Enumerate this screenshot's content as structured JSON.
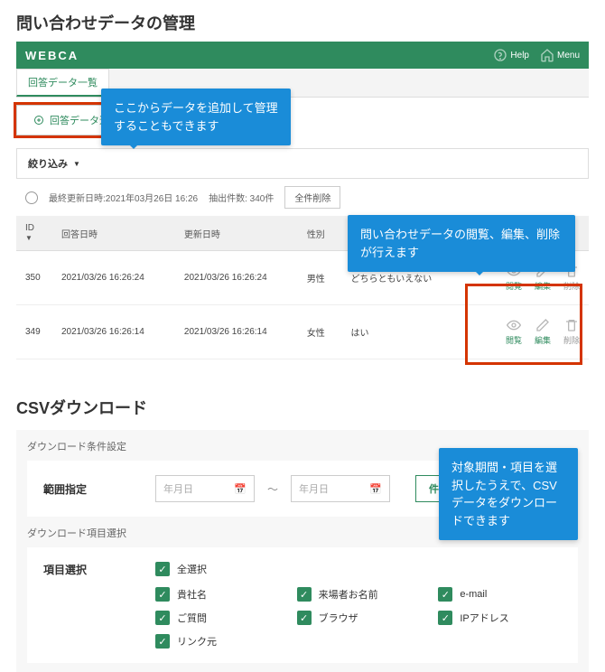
{
  "section1_title": "問い合わせデータの管理",
  "brand": "WEBCA",
  "top": {
    "help": "Help",
    "menu": "Menu"
  },
  "tab_label": "回答データ一覧",
  "add_btn": "回答データ追加",
  "filter_label": "絞り込み",
  "update": {
    "label": "最終更新日時:2021年03月26日 16:26",
    "count_label": "抽出件数: 340件",
    "delete_all": "全件削除"
  },
  "cols": {
    "id": "ID",
    "answered": "回答日時",
    "updated": "更新日時",
    "gender": "性別"
  },
  "rows": [
    {
      "id": "350",
      "answered": "2021/03/26 16:26:24",
      "updated": "2021/03/26 16:26:24",
      "gender": "男性",
      "ans": "どちらともいえない"
    },
    {
      "id": "349",
      "answered": "2021/03/26 16:26:14",
      "updated": "2021/03/26 16:26:14",
      "gender": "女性",
      "ans": "はい"
    }
  ],
  "act": {
    "view": "閲覧",
    "edit": "編集",
    "del": "削除"
  },
  "callouts": {
    "c1": "ここからデータを追加して管理することもできます",
    "c2": "問い合わせデータの閲覧、編集、削除が行えます",
    "c3": "対象期間・項目を選択したうえで、CSVデータをダウンロードできます"
  },
  "section2_title": "CSVダウンロード",
  "csv": {
    "cond_h": "ダウンロード条件設定",
    "range_label": "範囲指定",
    "date_ph": "年月日",
    "confirm": "件数確認",
    "items_h": "ダウンロード項目選択",
    "items_label": "項目選択",
    "select_all": "全選択",
    "items": [
      "貴社名",
      "来場者お名前",
      "e-mail",
      "ご質問",
      "ブラウザ",
      "IPアドレス",
      "リンク元"
    ]
  }
}
